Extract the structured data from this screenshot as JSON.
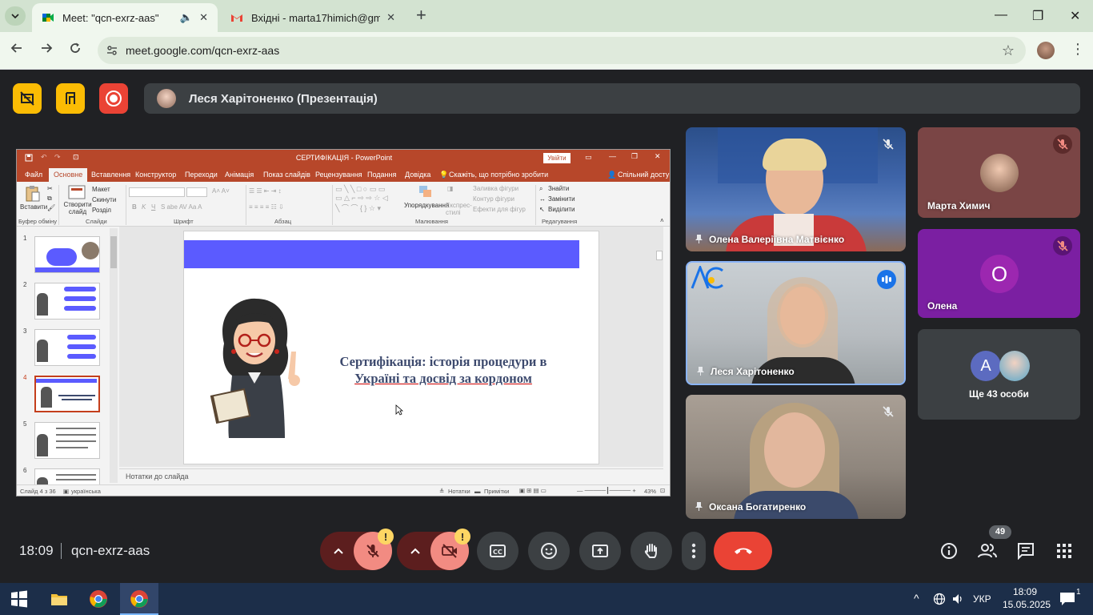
{
  "browser": {
    "tabs": [
      {
        "title": "Meet: \"qcn-exrz-aas\"",
        "active": true
      },
      {
        "title": "Вхідні - marta17himich@gmail.",
        "active": false
      }
    ],
    "url": "meet.google.com/qcn-exrz-aas"
  },
  "meet": {
    "presenter_label": "Леся Харітоненко (Презентація)",
    "time": "18:09",
    "meeting_code": "qcn-exrz-aas",
    "participants_count": "49",
    "others_count_label": "Ще 43 особи",
    "participants": [
      {
        "name": "Олена Валеріївна Матвієнко",
        "muted": true
      },
      {
        "name": "Марта Химич",
        "muted": true
      },
      {
        "name": "Леся Харітоненко",
        "muted": false,
        "speaking": true
      },
      {
        "name": "Олена",
        "muted": true,
        "initial": "O"
      },
      {
        "name": "Оксана Богатиренко",
        "muted": true
      }
    ],
    "others_avatar_initial": "A",
    "colors": {
      "end_call": "#ea4335",
      "muted_ctl": "#f28b82",
      "accent": "#8ab4f8"
    }
  },
  "ppt": {
    "window_title": "СЕРТИФІКАЦІЯ - PowerPoint",
    "signin_label": "Увійти",
    "tabs": [
      "Файл",
      "Основне",
      "Вставлення",
      "Конструктор",
      "Переходи",
      "Анімація",
      "Показ слайдів",
      "Рецензування",
      "Подання",
      "Довідка"
    ],
    "tell_me": "Скажіть, що потрібно зробити",
    "share": "Спільний доступ",
    "ribbon": {
      "paste": "Вставити",
      "clipboard_group": "Буфер обміну",
      "new_slide": "Створити слайд",
      "layout": "Макет",
      "reset": "Скинути",
      "section": "Розділ",
      "slides_group": "Слайди",
      "font_group": "Шрифт",
      "paragraph_group": "Абзац",
      "arrange": "Упорядкування",
      "quick_styles": "Експрес-стилі",
      "shape_fill": "Заливка фігури",
      "shape_outline": "Контур фігури",
      "shape_effects": "Ефекти для фігур",
      "drawing_group": "Малювання",
      "find": "Знайти",
      "replace": "Замінити",
      "select": "Виділити",
      "editing_group": "Редагування"
    },
    "slide_numbers": [
      "1",
      "2",
      "3",
      "4",
      "5",
      "6"
    ],
    "slide_title_line1": "Сертифікація: історія процедури в",
    "slide_title_line2": "Україні та досвід за кордоном",
    "notes_placeholder": "Нотатки до слайда",
    "status_slide": "Слайд 4 з 36",
    "status_lang": "українська",
    "status_notes": "Нотатки",
    "status_comments": "Примітки",
    "zoom": "43%"
  },
  "taskbar": {
    "lang": "УКР",
    "time": "18:09",
    "date": "15.05.2025",
    "notif_count": "1"
  }
}
